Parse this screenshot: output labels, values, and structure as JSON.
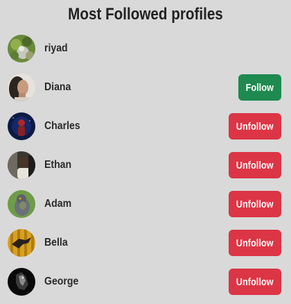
{
  "page": {
    "title": "Most Followed profiles"
  },
  "colors": {
    "background": "#d9d9d9",
    "follow": "#1e8a4f",
    "unfollow": "#dc3545"
  },
  "profiles": [
    {
      "name": "riyad",
      "avatar": "avatar-riyad",
      "button": ""
    },
    {
      "name": "Diana",
      "avatar": "avatar-diana",
      "button": "Follow"
    },
    {
      "name": "Charles",
      "avatar": "avatar-charles",
      "button": "Unfollow"
    },
    {
      "name": "Ethan",
      "avatar": "avatar-ethan",
      "button": "Unfollow"
    },
    {
      "name": "Adam",
      "avatar": "avatar-adam",
      "button": "Unfollow"
    },
    {
      "name": "Bella",
      "avatar": "avatar-bella",
      "button": "Unfollow"
    },
    {
      "name": "George",
      "avatar": "avatar-george",
      "button": "Unfollow"
    }
  ]
}
